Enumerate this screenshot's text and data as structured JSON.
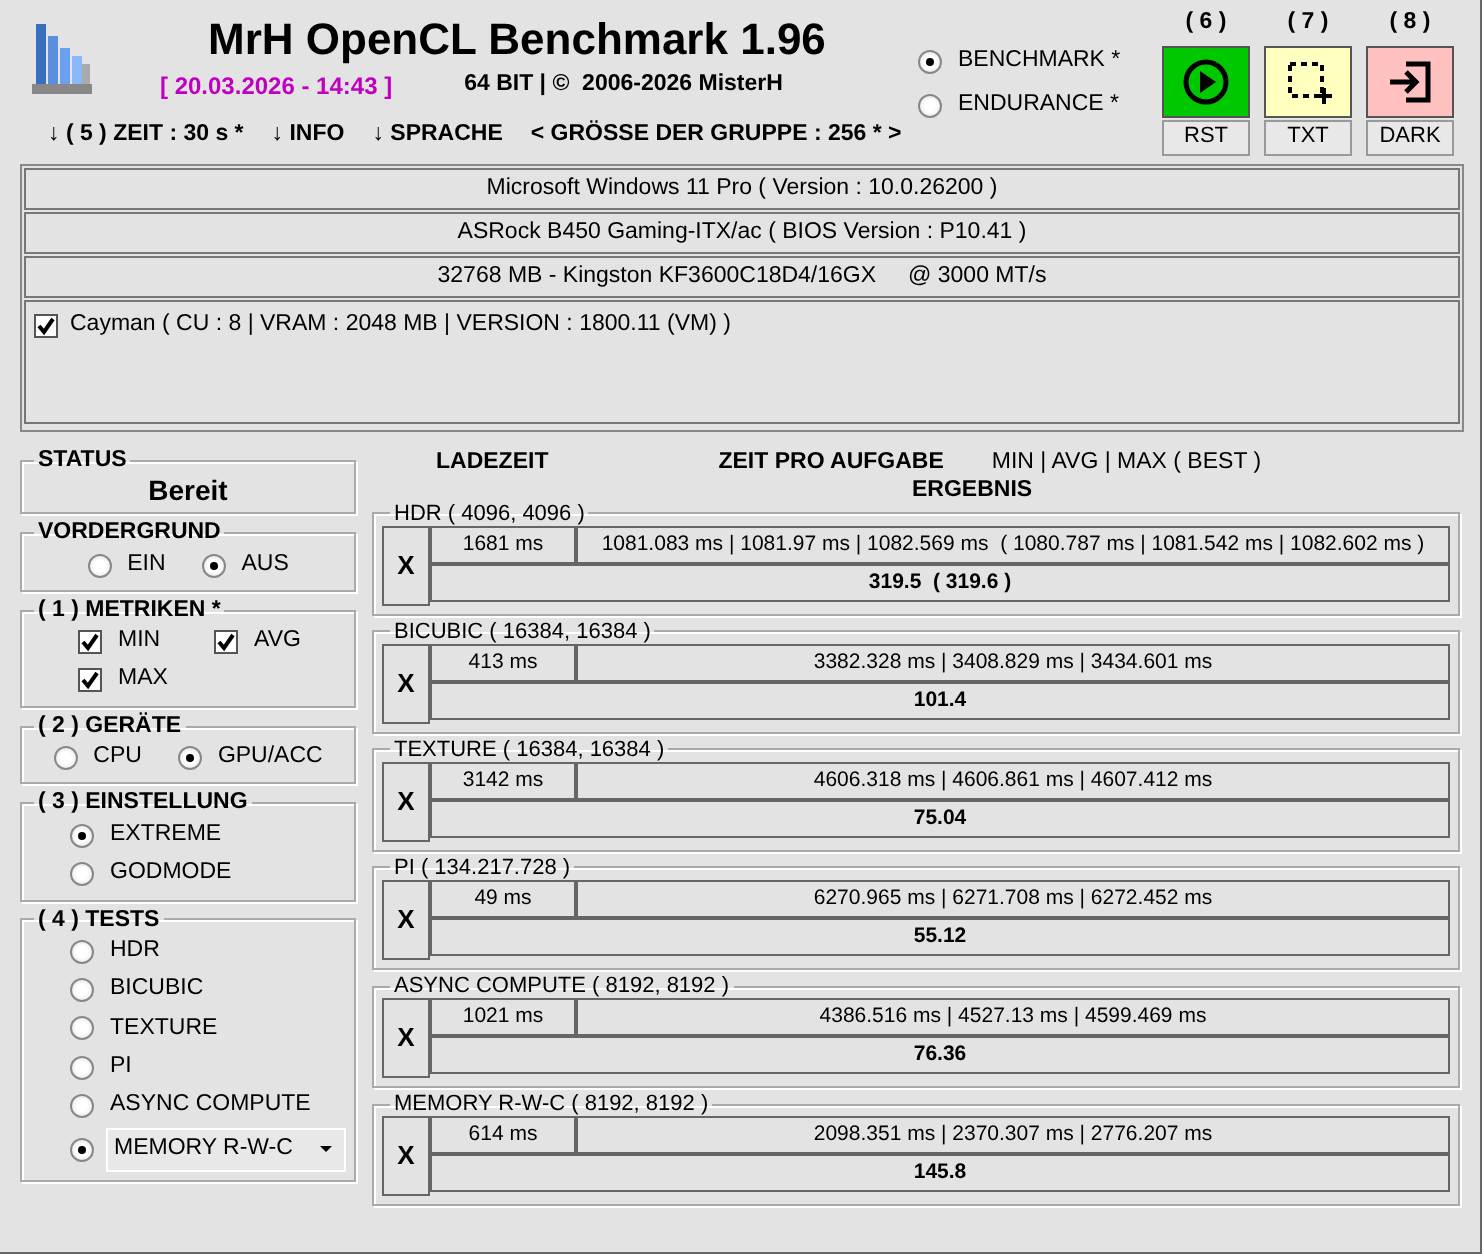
{
  "title": "MrH OpenCL Benchmark 1.96",
  "date": "[ 20.03.2026 - 14:43 ]",
  "build": "64 BIT | ©  2006-2026 MisterH",
  "modes": [
    {
      "label": "BENCHMARK *",
      "selected": true
    },
    {
      "label": "ENDURANCE *",
      "selected": false
    }
  ],
  "actions": [
    {
      "number": "( 6 )",
      "kind": "play",
      "caption": "RST"
    },
    {
      "number": "( 7 )",
      "kind": "select",
      "caption": "TXT"
    },
    {
      "number": "( 8 )",
      "kind": "exit",
      "caption": "DARK"
    }
  ],
  "menu": [
    "↓ ( 5 ) ZEIT : 30 s *",
    "↓ INFO",
    "↓ SPRACHE",
    "< GRÖSSE DER GRUPPE : 256 * >"
  ],
  "system_info": [
    "Microsoft Windows 11 Pro ( Version : 10.0.26200 )",
    "ASRock B450 Gaming-ITX/ac ( BIOS Version : P10.41 )",
    "32768 MB - Kingston KF3600C18D4/16GX     @ 3000 MT/s"
  ],
  "devices": [
    {
      "label": "Cayman ( CU : 8 | VRAM : 2048 MB | VERSION : 1800.11 (VM) )",
      "checked": true
    }
  ],
  "status": {
    "title": "STATUS",
    "value": "Bereit"
  },
  "groups": [
    {
      "title": "VORDERGRUND",
      "kind": "inline",
      "options": [
        {
          "label": "EIN",
          "selected": false
        },
        {
          "label": "AUS",
          "selected": true
        }
      ]
    },
    {
      "title": "( 1 ) METRIKEN *",
      "kind": "grid",
      "options": [
        {
          "label": "MIN",
          "checked": true
        },
        {
          "label": "AVG",
          "checked": true
        },
        {
          "label": "MAX",
          "checked": true
        }
      ]
    },
    {
      "title": "( 2 ) GERÄTE",
      "kind": "inline",
      "options": [
        {
          "label": "CPU",
          "selected": false
        },
        {
          "label": "GPU/ACC",
          "selected": true
        }
      ]
    },
    {
      "title": "( 3 ) EINSTELLUNG",
      "kind": "stacked",
      "options": [
        {
          "label": "EXTREME",
          "selected": true
        },
        {
          "label": "GODMODE",
          "selected": false
        }
      ]
    },
    {
      "title": "( 4 ) TESTS",
      "kind": "stacked",
      "options": [
        {
          "label": "HDR",
          "selected": false,
          "kind": "plain"
        },
        {
          "label": "BICUBIC",
          "selected": false,
          "kind": "plain"
        },
        {
          "label": "TEXTURE",
          "selected": false,
          "kind": "plain"
        },
        {
          "label": "PI",
          "selected": false,
          "kind": "plain"
        },
        {
          "label": "ASYNC COMPUTE",
          "selected": false,
          "kind": "plain"
        },
        {
          "label": "MEMORY R-W-C",
          "selected": true,
          "kind": "dropdown"
        }
      ]
    }
  ],
  "result_headers": {
    "load": "LADEZEIT",
    "time": "ZEIT PRO AUFGABE",
    "metrics": "MIN | AVG | MAX ( BEST )",
    "result": "ERGEBNIS"
  },
  "tests": [
    {
      "title": "HDR ( 4096, 4096 )",
      "button": "X",
      "load": "1681 ms",
      "times": "1081.083 ms | 1081.97 ms | 1082.569 ms  ( 1080.787 ms | 1081.542 ms | 1082.602 ms )",
      "result": "319.5  ( 319.6 )"
    },
    {
      "title": "BICUBIC ( 16384, 16384 )",
      "button": "X",
      "load": "413 ms",
      "times": "3382.328 ms | 3408.829 ms | 3434.601 ms",
      "result": "101.4"
    },
    {
      "title": "TEXTURE ( 16384, 16384 )",
      "button": "X",
      "load": "3142 ms",
      "times": "4606.318 ms | 4606.861 ms | 4607.412 ms",
      "result": "75.04"
    },
    {
      "title": "PI ( 134.217.728 )",
      "button": "X",
      "load": "49 ms",
      "times": "6270.965 ms | 6271.708 ms | 6272.452 ms",
      "result": "55.12"
    },
    {
      "title": "ASYNC COMPUTE ( 8192, 8192 )",
      "button": "X",
      "load": "1021 ms",
      "times": "4386.516 ms | 4527.13 ms | 4599.469 ms",
      "result": "76.36"
    },
    {
      "title": "MEMORY R-W-C ( 8192, 8192 )",
      "button": "X",
      "load": "614 ms",
      "times": "2098.351 ms | 2370.307 ms | 2776.207 ms",
      "result": "145.8"
    }
  ]
}
